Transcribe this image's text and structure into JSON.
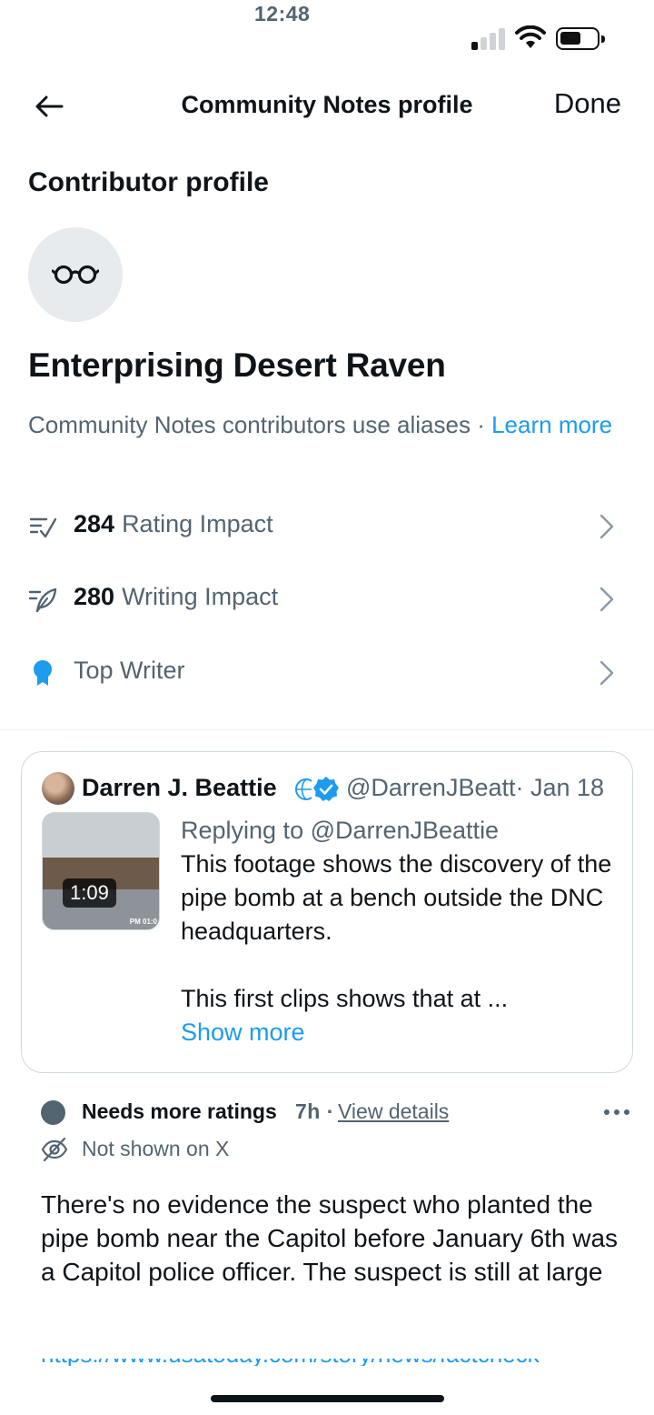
{
  "status_bar": {
    "time": "12:48"
  },
  "nav": {
    "title": "Community Notes profile",
    "done_label": "Done"
  },
  "profile": {
    "section_heading": "Contributor profile",
    "alias": "Enterprising Desert Raven",
    "description": "Community Notes contributors use aliases · ",
    "learn_more": "Learn more",
    "stats": [
      {
        "icon": "rating-impact-icon",
        "value": "284",
        "label": "Rating Impact"
      },
      {
        "icon": "writing-impact-icon",
        "value": "280",
        "label": "Writing Impact"
      },
      {
        "icon": "top-writer-badge-icon",
        "value": "",
        "label": "Top Writer"
      }
    ]
  },
  "quoted_post": {
    "author_name": "Darren J. Beattie",
    "handle_date": "@DarrenJBeatt· Jan 18",
    "video_duration": "1:09",
    "video_stamp": "PM 01:0",
    "replying_to": "Replying to @DarrenJBeattie",
    "text_line1": "This footage shows the discovery of the pipe bomb at a bench outside the DNC headquarters.",
    "text_line2": "This first clips shows that at ...",
    "show_more": "Show more"
  },
  "note": {
    "status": "Needs more ratings",
    "time": "7h ·",
    "view_details": "View details",
    "visibility": "Not shown on X",
    "text": "There's no evidence the suspect who planted the pipe bomb near the Capitol before January 6th was a Capitol police officer. The suspect is still at large",
    "link_partial": "https://www.usatoday.com/story/news/factcheck"
  },
  "colors": {
    "accent": "#1d9bf0",
    "secondary_text": "#536471",
    "primary_text": "#0f1419"
  }
}
